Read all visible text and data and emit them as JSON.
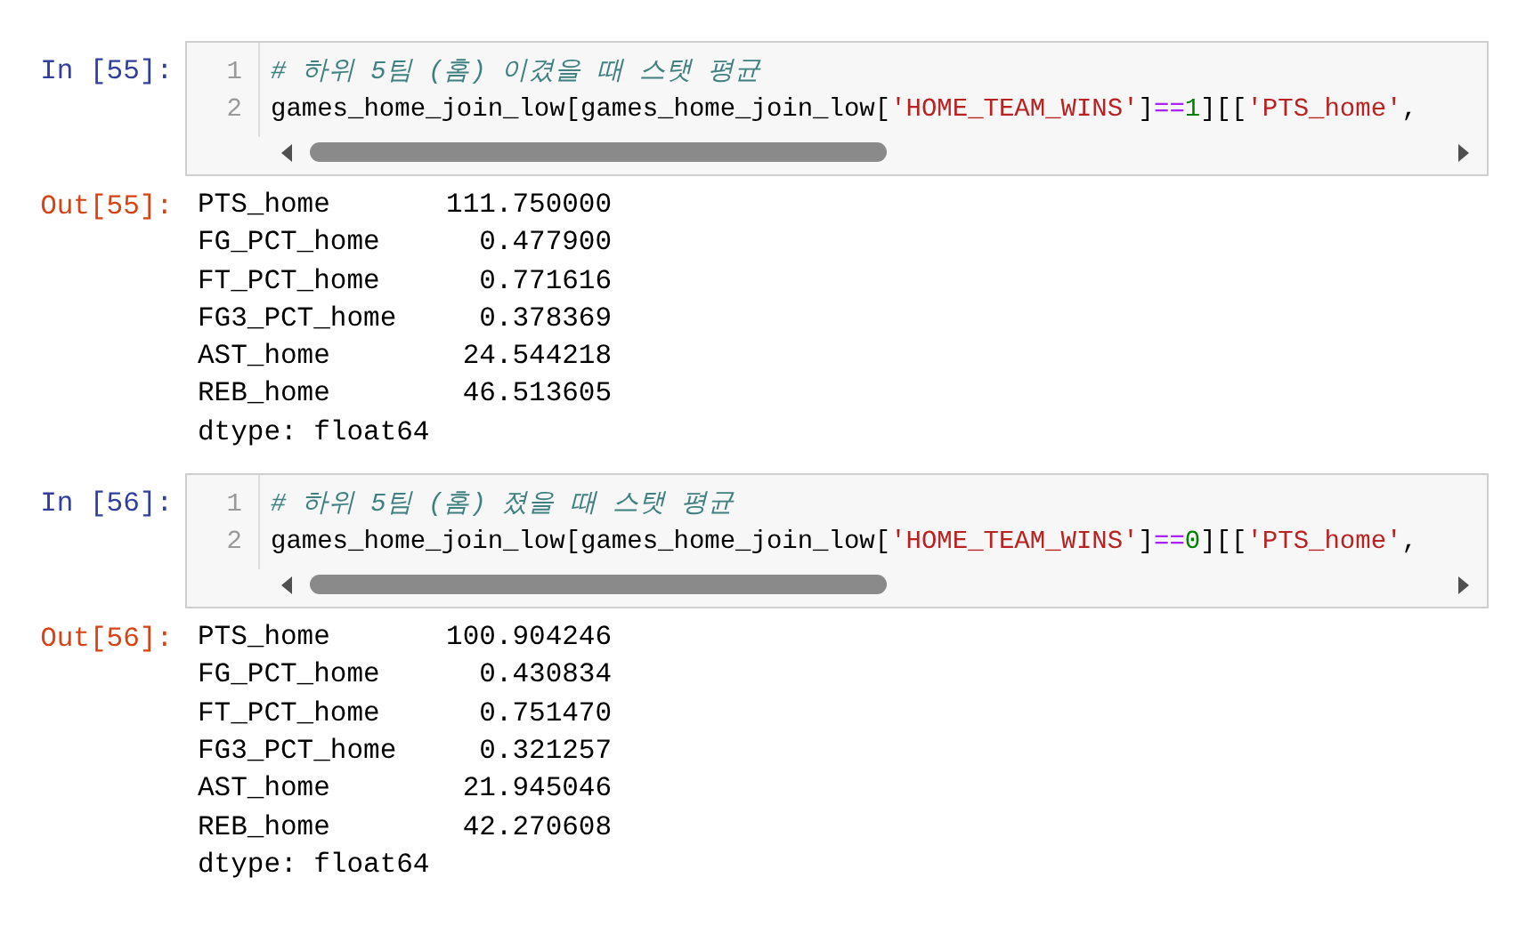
{
  "cells": [
    {
      "input_prompt": "In [55]:",
      "lines": [
        {
          "number": "1",
          "tokens": [
            {
              "kind": "comment",
              "text": "# 하위 5팀 (홈) 이겼을 때 스탯 평균"
            }
          ]
        },
        {
          "number": "2",
          "tokens": [
            {
              "kind": "plain",
              "text": "games_home_join_low[games_home_join_low["
            },
            {
              "kind": "string",
              "text": "'HOME_TEAM_WINS'"
            },
            {
              "kind": "plain",
              "text": "]"
            },
            {
              "kind": "operator",
              "text": "=="
            },
            {
              "kind": "number",
              "text": "1"
            },
            {
              "kind": "plain",
              "text": "][["
            },
            {
              "kind": "string",
              "text": "'PTS_home'"
            },
            {
              "kind": "plain",
              "text": ","
            }
          ]
        }
      ],
      "output_prompt": "Out[55]:",
      "output": [
        "PTS_home       111.750000",
        "FG_PCT_home      0.477900",
        "FT_PCT_home      0.771616",
        "FG3_PCT_home     0.378369",
        "AST_home        24.544218",
        "REB_home        46.513605",
        "dtype: float64"
      ]
    },
    {
      "input_prompt": "In [56]:",
      "lines": [
        {
          "number": "1",
          "tokens": [
            {
              "kind": "comment",
              "text": "# 하위 5팀 (홈) 졌을 때 스탯 평균"
            }
          ]
        },
        {
          "number": "2",
          "tokens": [
            {
              "kind": "plain",
              "text": "games_home_join_low[games_home_join_low["
            },
            {
              "kind": "string",
              "text": "'HOME_TEAM_WINS'"
            },
            {
              "kind": "plain",
              "text": "]"
            },
            {
              "kind": "operator",
              "text": "=="
            },
            {
              "kind": "number",
              "text": "0"
            },
            {
              "kind": "plain",
              "text": "][["
            },
            {
              "kind": "string",
              "text": "'PTS_home'"
            },
            {
              "kind": "plain",
              "text": ","
            }
          ]
        }
      ],
      "output_prompt": "Out[56]:",
      "output": [
        "PTS_home       100.904246",
        "FG_PCT_home      0.430834",
        "FT_PCT_home      0.751470",
        "FG3_PCT_home     0.321257",
        "AST_home        21.945046",
        "REB_home        42.270608",
        "dtype: float64"
      ]
    }
  ]
}
